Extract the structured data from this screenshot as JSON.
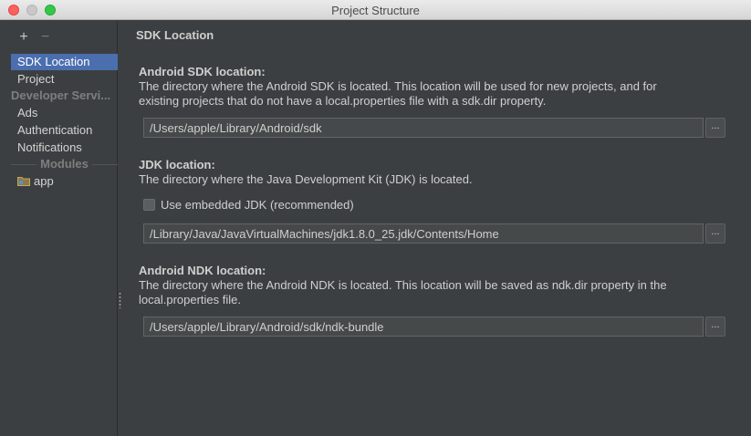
{
  "window": {
    "title": "Project Structure"
  },
  "sidebar": {
    "add_symbol": "+",
    "remove_symbol": "−",
    "items": [
      {
        "label": "SDK Location",
        "selected": true
      },
      {
        "label": "Project"
      }
    ],
    "developer_services_header": "Developer Servi...",
    "developer_services": [
      {
        "label": "Ads"
      },
      {
        "label": "Authentication"
      },
      {
        "label": "Notifications"
      }
    ],
    "modules_header": "Modules",
    "modules": [
      {
        "label": "app",
        "icon": "folder-icon"
      }
    ]
  },
  "main": {
    "section_title": "SDK Location",
    "android_sdk": {
      "label": "Android SDK location:",
      "description_line1": "The directory where the Android SDK is located. This location will be used for new projects, and for",
      "description_line2": "existing projects that do not have a local.properties file with a sdk.dir property.",
      "path": "/Users/apple/Library/Android/sdk",
      "browse_label": "..."
    },
    "jdk": {
      "label": "JDK location:",
      "description": "The directory where the Java Development Kit (JDK) is located.",
      "embedded_checkbox_label": "Use embedded JDK (recommended)",
      "embedded_checked": false,
      "path": "/Library/Java/JavaVirtualMachines/jdk1.8.0_25.jdk/Contents/Home",
      "browse_label": "..."
    },
    "android_ndk": {
      "label": "Android NDK location:",
      "description_line1": "The directory where the Android NDK is located. This location will be saved as ndk.dir property in the",
      "description_line2": "local.properties file.",
      "path": "/Users/apple/Library/Android/sdk/ndk-bundle",
      "browse_label": "..."
    }
  },
  "colors": {
    "background": "#3c3f41",
    "selection": "#4b6eaf",
    "field_background": "#45494a",
    "text": "#cfcfcf"
  }
}
